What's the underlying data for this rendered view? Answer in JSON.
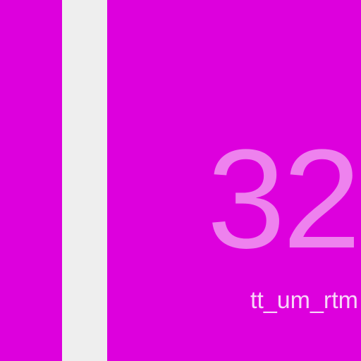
{
  "display": {
    "number": "32",
    "label": "tt_um_rtm",
    "colors": {
      "background": "#dd00dd",
      "strip": "#eeeeee",
      "number": "#ee82ee",
      "label": "#f8d6f8"
    }
  }
}
